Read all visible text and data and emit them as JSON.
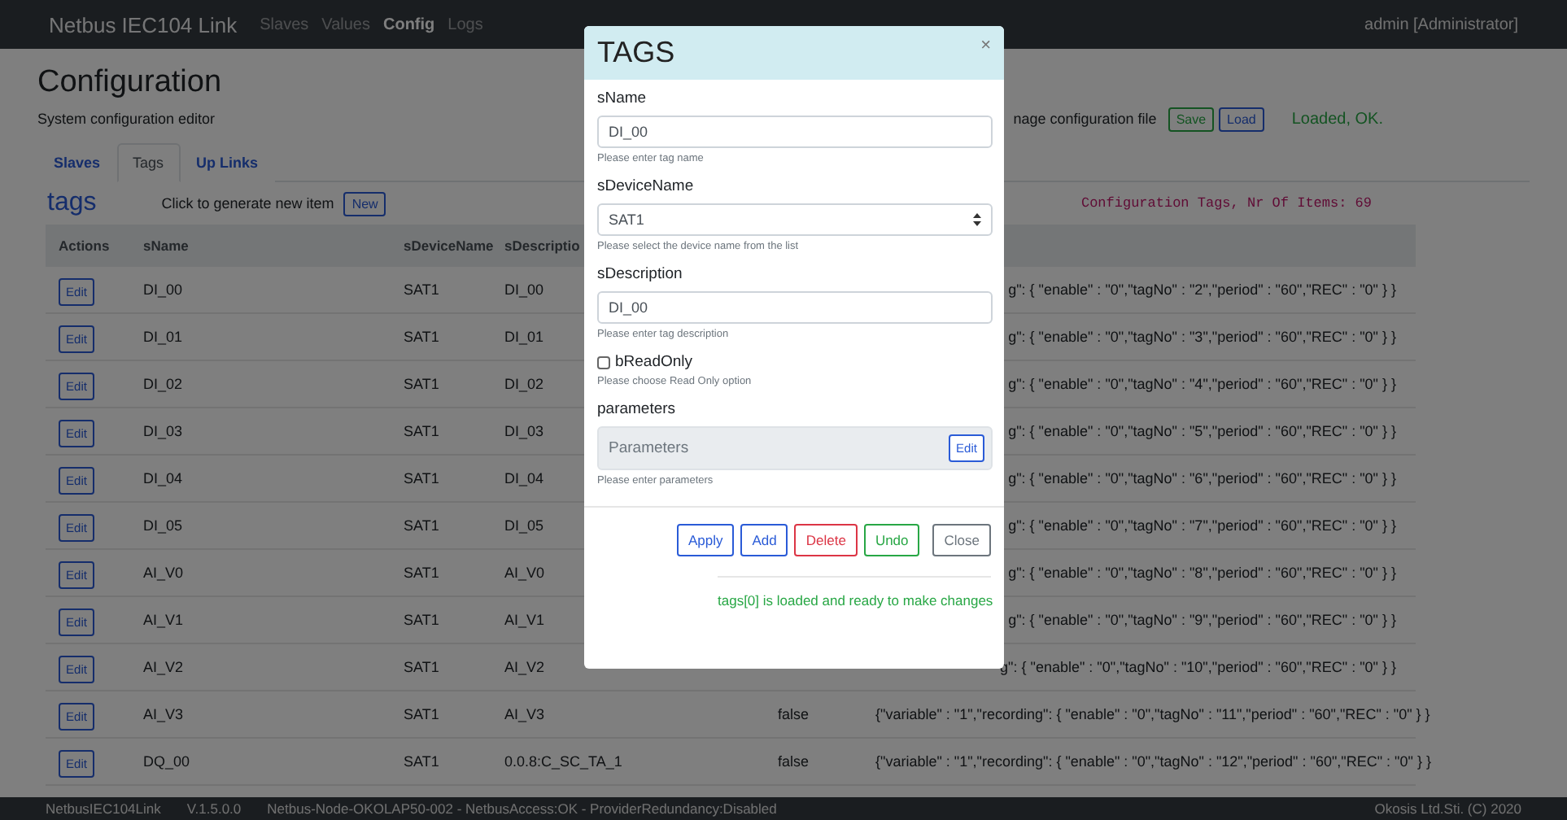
{
  "navbar": {
    "brand": "Netbus IEC104 Link",
    "links": [
      {
        "label": "Slaves",
        "selected": false
      },
      {
        "label": "Values",
        "selected": false
      },
      {
        "label": "Config",
        "selected": true
      },
      {
        "label": "Logs",
        "selected": false
      }
    ],
    "user": "admin [Administrator]"
  },
  "page": {
    "title": "Configuration",
    "subtitle": "System configuration editor",
    "file_label": "nage configuration file",
    "save": "Save",
    "load": "Load",
    "file_status": "Loaded, OK."
  },
  "tabs": [
    {
      "label": "Slaves",
      "selected": false
    },
    {
      "label": "Tags",
      "selected": true
    },
    {
      "label": "Up Links",
      "selected": false
    }
  ],
  "section": {
    "title": "tags",
    "new_hint": "Click to generate new item",
    "new_button": "New",
    "count": "Configuration Tags, Nr Of Items: 69"
  },
  "table": {
    "columns": [
      "Actions",
      "sName",
      "sDeviceName",
      "sDescriptio"
    ],
    "rows": [
      {
        "action": "Edit",
        "name": "DI_00",
        "device": "SAT1",
        "description": "DI_00",
        "value": "g\": { \"enable\" : \"0\",\"tagNo\" : \"2\",\"period\" : \"60\",\"REC\" : \"0\" } }"
      },
      {
        "action": "Edit",
        "name": "DI_01",
        "device": "SAT1",
        "description": "DI_01",
        "value": "g\": { \"enable\" : \"0\",\"tagNo\" : \"3\",\"period\" : \"60\",\"REC\" : \"0\" } }"
      },
      {
        "action": "Edit",
        "name": "DI_02",
        "device": "SAT1",
        "description": "DI_02",
        "value": "g\": { \"enable\" : \"0\",\"tagNo\" : \"4\",\"period\" : \"60\",\"REC\" : \"0\" } }"
      },
      {
        "action": "Edit",
        "name": "DI_03",
        "device": "SAT1",
        "description": "DI_03",
        "value": "g\": { \"enable\" : \"0\",\"tagNo\" : \"5\",\"period\" : \"60\",\"REC\" : \"0\" } }"
      },
      {
        "action": "Edit",
        "name": "DI_04",
        "device": "SAT1",
        "description": "DI_04",
        "value": "g\": { \"enable\" : \"0\",\"tagNo\" : \"6\",\"period\" : \"60\",\"REC\" : \"0\" } }"
      },
      {
        "action": "Edit",
        "name": "DI_05",
        "device": "SAT1",
        "description": "DI_05",
        "value": "g\": { \"enable\" : \"0\",\"tagNo\" : \"7\",\"period\" : \"60\",\"REC\" : \"0\" } }"
      },
      {
        "action": "Edit",
        "name": "AI_V0",
        "device": "SAT1",
        "description": "AI_V0",
        "value": "g\": { \"enable\" : \"0\",\"tagNo\" : \"8\",\"period\" : \"60\",\"REC\" : \"0\" } }"
      },
      {
        "action": "Edit",
        "name": "AI_V1",
        "device": "SAT1",
        "description": "AI_V1",
        "value": "g\": { \"enable\" : \"0\",\"tagNo\" : \"9\",\"period\" : \"60\",\"REC\" : \"0\" } }"
      },
      {
        "action": "Edit",
        "name": "AI_V2",
        "device": "SAT1",
        "description": "AI_V2",
        "value": "g\": { \"enable\" : \"0\",\"tagNo\" : \"10\",\"period\" : \"60\",\"REC\" : \"0\" } }"
      },
      {
        "action": "Edit",
        "name": "AI_V3",
        "device": "SAT1",
        "description": "AI_V3",
        "flag": "false",
        "value": "{\"variable\" : \"1\",\"recording\": { \"enable\" : \"0\",\"tagNo\" : \"11\",\"period\" : \"60\",\"REC\" : \"0\" } }"
      },
      {
        "action": "Edit",
        "name": "DQ_00",
        "device": "SAT1",
        "description": "0.0.8:C_SC_TA_1",
        "flag": "false",
        "value": "{\"variable\" : \"1\",\"recording\": { \"enable\" : \"0\",\"tagNo\" : \"12\",\"period\" : \"60\",\"REC\" : \"0\" } }"
      }
    ]
  },
  "footer": {
    "items": [
      "NetbusIEC104Link",
      "V.1.5.0.0",
      "Netbus-Node-OKOLAP50-002 - NetbusAccess:OK - ProviderRedundancy:Disabled"
    ],
    "copyright": "Okosis Ltd.Sti. (C) 2020"
  },
  "modal": {
    "title": "TAGS",
    "close": "×",
    "fields": [
      {
        "kind": "text",
        "label": "sName",
        "value": "DI_00",
        "help": "Please enter tag name"
      },
      {
        "kind": "select",
        "label": "sDeviceName",
        "value": "SAT1",
        "help": "Please select the device name from the list"
      },
      {
        "kind": "text",
        "label": "sDescription",
        "value": "DI_00",
        "help": "Please enter tag description"
      },
      {
        "kind": "checkbox",
        "label": "bReadOnly",
        "checked": false,
        "help": "Please choose Read Only option"
      },
      {
        "kind": "group",
        "label": "parameters",
        "placeholder": "Parameters",
        "button": "Edit",
        "help": "Please enter parameters"
      }
    ],
    "buttons": [
      {
        "label": "Apply",
        "kind": "primary"
      },
      {
        "label": "Add",
        "kind": "primary"
      },
      {
        "label": "Delete",
        "kind": "danger"
      },
      {
        "label": "Undo",
        "kind": "success"
      },
      {
        "label": "Close",
        "kind": "secondary"
      }
    ],
    "status": "tags[0] is loaded and ready to make changes"
  }
}
